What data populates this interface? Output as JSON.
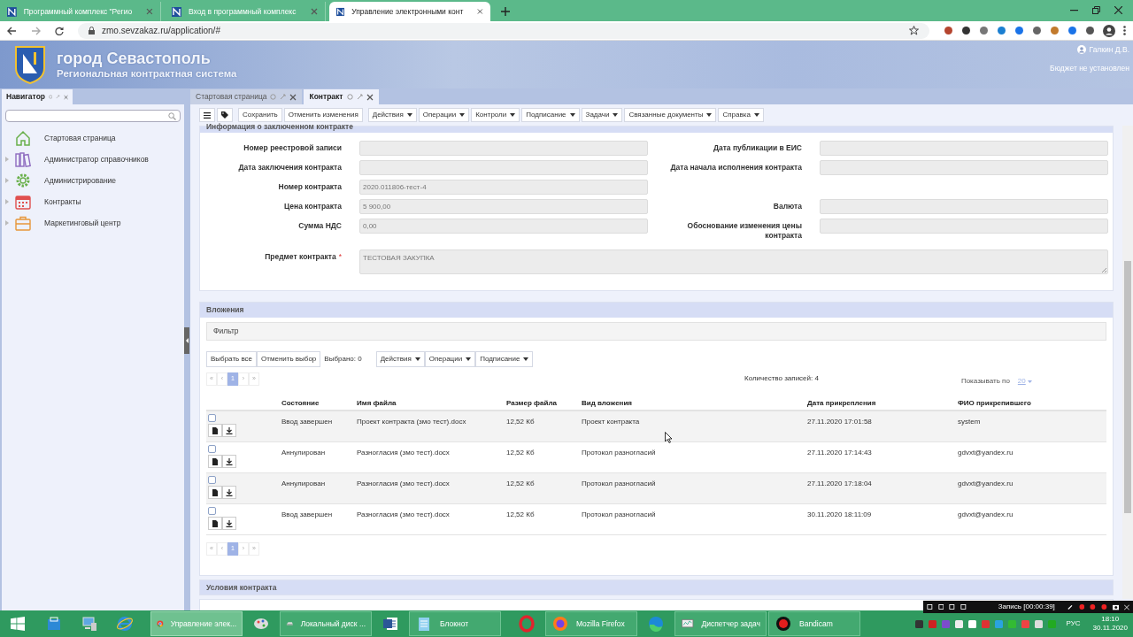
{
  "browser": {
    "tabs": [
      {
        "title": "Программный комплекс \"Регио",
        "selected": false
      },
      {
        "title": "Вход в программный комплекс",
        "selected": false
      },
      {
        "title": "Управление электронными конт",
        "selected": true
      }
    ],
    "url": "zmo.sevzakaz.ru/application/#"
  },
  "header": {
    "city": "город Севастополь",
    "subtitle": "Региональная контрактная система",
    "user": "Галкин Д.В.",
    "budget": "Бюджет не установлен"
  },
  "navigator": {
    "title": "Навигатор",
    "items": [
      {
        "label": "Стартовая страница",
        "expandable": false
      },
      {
        "label": "Администратор справочников",
        "expandable": true
      },
      {
        "label": "Администрирование",
        "expandable": true
      },
      {
        "label": "Контракты",
        "expandable": true
      },
      {
        "label": "Маркетинговый центр",
        "expandable": true
      }
    ]
  },
  "doc_tabs": [
    {
      "label": "Стартовая страница",
      "selected": false
    },
    {
      "label": "Контракт",
      "selected": true
    }
  ],
  "toolbar": [
    {
      "label": "Сохранить",
      "dropdown": false
    },
    {
      "label": "Отменить изменения",
      "dropdown": false
    },
    {
      "label": "Действия",
      "dropdown": true
    },
    {
      "label": "Операции",
      "dropdown": true
    },
    {
      "label": "Контроли",
      "dropdown": true
    },
    {
      "label": "Подписание",
      "dropdown": true
    },
    {
      "label": "Задачи",
      "dropdown": true
    },
    {
      "label": "Связанные документы",
      "dropdown": true
    },
    {
      "label": "Справка",
      "dropdown": true
    }
  ],
  "contract_info": {
    "title": "Информация о заключенном контракте",
    "rows": [
      {
        "left": {
          "label": "Номер реестровой записи"
        },
        "right": {
          "label": "Дата публикации в ЕИС"
        }
      },
      {
        "left": {
          "label": "Дата заключения контракта"
        },
        "right": {
          "label": "Дата начала исполнения контракта"
        }
      },
      {
        "left": {
          "label": "Номер контракта",
          "value": "2020.011806-тест-4"
        }
      },
      {
        "left": {
          "label": "Цена контракта",
          "value": "5 900,00"
        },
        "right": {
          "label": "Валюта"
        }
      },
      {
        "left": {
          "label": "Сумма НДС",
          "value": "0,00"
        },
        "right": {
          "label": "Обоснование изменения цены контракта"
        }
      }
    ],
    "subject": {
      "label": "Предмет контракта",
      "required_mark": "*",
      "value": "ТЕСТОВАЯ ЗАКУПКА"
    }
  },
  "attachments": {
    "title": "Вложения",
    "filter": "Фильтр",
    "select_buttons": [
      "Выбрать все",
      "Отменить выбор"
    ],
    "selected_count": "Выбрано: 0",
    "menus": [
      "Действия",
      "Операции",
      "Подписание"
    ],
    "pager": {
      "first": "«",
      "prev": "‹",
      "pages": [
        {
          "label": "1",
          "selected": true
        }
      ],
      "next": "›",
      "last": "»"
    },
    "record_count": "Количество записей: 4",
    "page_size_label": "Показывать по",
    "page_size": "20",
    "table": {
      "columns": [
        "Состояние",
        "Имя файла",
        "Размер файла",
        "Вид вложения",
        "Дата прикрепления",
        "ФИО прикрепившего"
      ],
      "rows": [
        {
          "checked": false,
          "cells": [
            "Ввод завершен",
            "Проект контракта (змо тест).docx",
            "12,52 Кб",
            "Проект контракта",
            "27.11.2020 17:01:58",
            "system"
          ]
        },
        {
          "checked": false,
          "cells": [
            "Аннулирован",
            "Разногласия (змо тест).docx",
            "12,52 Кб",
            "Протокол разногласий",
            "27.11.2020 17:14:43",
            "gdvxt@yandex.ru"
          ]
        },
        {
          "checked": false,
          "cells": [
            "Аннулирован",
            "Разногласия (змо тест).docx",
            "12,52 Кб",
            "Протокол разногласий",
            "27.11.2020 17:18:04",
            "gdvxt@yandex.ru"
          ]
        },
        {
          "checked": false,
          "cells": [
            "Ввод завершен",
            "Разногласия (змо тест).docx",
            "12,52 Кб",
            "Протокол разногласий",
            "30.11.2020 18:11:09",
            "gdvxt@yandex.ru"
          ]
        }
      ]
    },
    "pager_bottom": {
      "first": "«",
      "prev": "‹",
      "pages": [
        {
          "label": "1",
          "selected": true
        }
      ],
      "next": "›",
      "last": "»"
    }
  },
  "next_section": {
    "title": "Условия контракта"
  },
  "recorder": {
    "status": "Запись [00:00:39]"
  },
  "taskbar": {
    "items": [
      {
        "kind": "store",
        "active": false
      },
      {
        "kind": "computer",
        "active": false
      },
      {
        "kind": "ie",
        "active": false
      },
      {
        "kind": "chrome",
        "label": "Управление элек...",
        "active": true
      },
      {
        "kind": "paint",
        "active": false
      },
      {
        "kind": "disk",
        "label": "Локальный диск ...",
        "active": false
      },
      {
        "kind": "word",
        "active": false
      },
      {
        "kind": "notepad",
        "label": "Блокнот",
        "active": false
      },
      {
        "kind": "opera",
        "active": false
      },
      {
        "kind": "firefox",
        "label": "Mozilla Firefox",
        "active": false
      },
      {
        "kind": "edge",
        "active": false
      },
      {
        "kind": "taskmgr",
        "label": "Диспетчер задач",
        "active": false
      },
      {
        "kind": "bandicam",
        "label": "Bandicam",
        "active": false
      }
    ],
    "language": "РУС",
    "time": "18:10",
    "date": "30.11.2020"
  }
}
